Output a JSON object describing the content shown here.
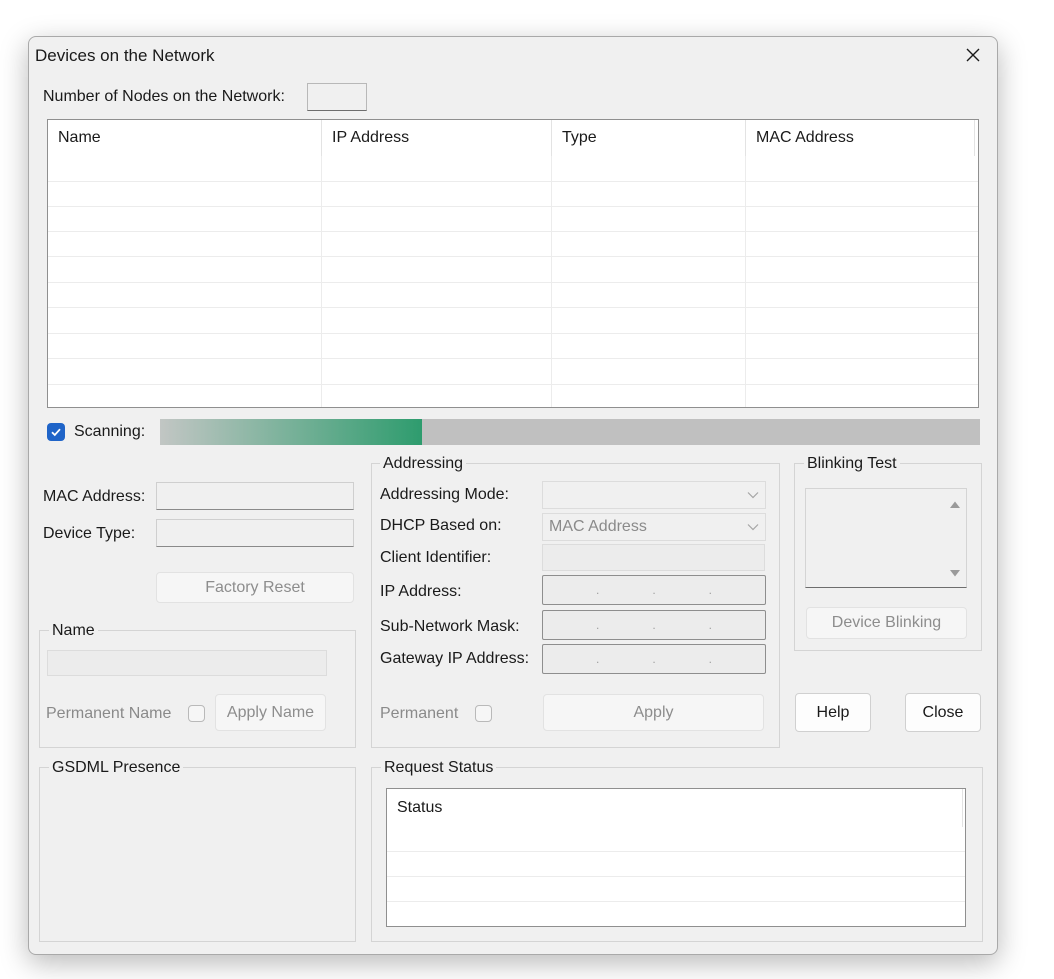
{
  "window": {
    "title": "Devices on the Network",
    "close_icon": "close-icon"
  },
  "nodes": {
    "label": "Number of Nodes on the Network:",
    "value": ""
  },
  "devices_table": {
    "columns": [
      "Name",
      "IP Address",
      "Type",
      "MAC Address"
    ],
    "rows": []
  },
  "scanning": {
    "label": "Scanning:",
    "checked": true,
    "progress_fraction": 0.32,
    "accent": "#2e9c6e"
  },
  "device": {
    "mac_label": "MAC Address:",
    "mac_value": "",
    "type_label": "Device Type:",
    "type_value": "",
    "factory_reset": "Factory Reset"
  },
  "name_group": {
    "title": "Name",
    "value": "",
    "permanent_label": "Permanent Name",
    "apply_label": "Apply Name"
  },
  "gsdml_group": {
    "title": "GSDML Presence"
  },
  "addressing": {
    "title": "Addressing",
    "mode_label": "Addressing Mode:",
    "mode_value": "",
    "dhcp_label": "DHCP Based on:",
    "dhcp_value": "MAC Address",
    "client_label": "Client Identifier:",
    "client_value": "",
    "ip_label": "IP Address:",
    "mask_label": "Sub-Network Mask:",
    "gateway_label": "Gateway IP Address:",
    "permanent_label": "Permanent",
    "apply_label": "Apply"
  },
  "blinking": {
    "title": "Blinking Test",
    "button": "Device Blinking"
  },
  "buttons": {
    "help": "Help",
    "close": "Close"
  },
  "request_status": {
    "title": "Request Status",
    "column": "Status",
    "rows": []
  }
}
